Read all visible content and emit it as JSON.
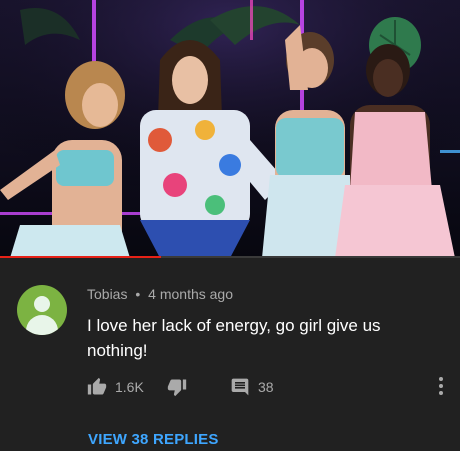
{
  "video": {
    "progress_fraction": 0.35
  },
  "comment": {
    "author": "Tobias",
    "separator": "•",
    "time": "4 months ago",
    "text": "I love her lack of energy, go girl give us nothing!",
    "likes": "1.6K",
    "reply_count": "38",
    "view_replies": "VIEW 38 REPLIES",
    "avatar_color": "#7cb342"
  },
  "icons": {
    "like": "thumbs-up-icon",
    "dislike": "thumbs-down-icon",
    "reply": "comment-icon",
    "menu": "more-vert-icon"
  },
  "colors": {
    "background": "#212121",
    "link": "#3ea6ff",
    "progress": "#e62117"
  }
}
